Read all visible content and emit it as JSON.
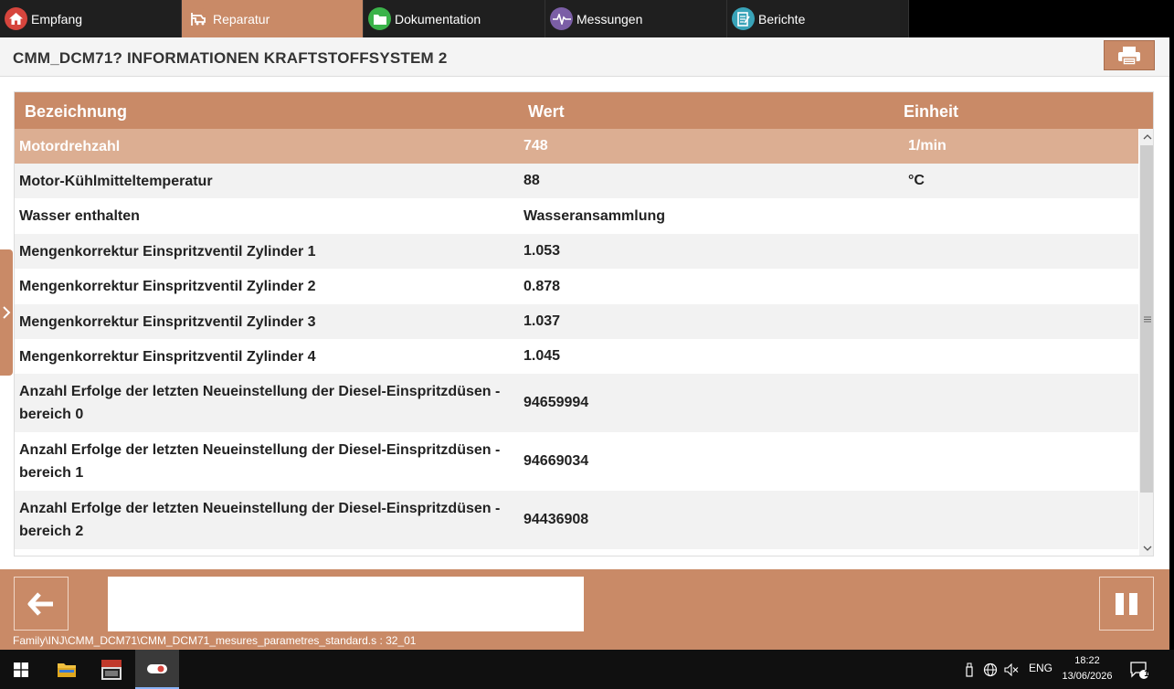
{
  "nav": {
    "tabs": [
      {
        "label": "Empfang",
        "icon": "home-icon",
        "color": "#d6453d"
      },
      {
        "label": "Reparatur",
        "icon": "lift-icon",
        "color": "#c98a67"
      },
      {
        "label": "Dokumentation",
        "icon": "folder-icon",
        "color": "#3bb34a"
      },
      {
        "label": "Messungen",
        "icon": "waveform-icon",
        "color": "#7b5ea6"
      },
      {
        "label": "Berichte",
        "icon": "report-icon",
        "color": "#39a3b8"
      }
    ],
    "active": "Reparatur"
  },
  "header": {
    "title": "CMM_DCM71? INFORMATIONEN KRAFTSTOFFSYSTEM 2"
  },
  "table": {
    "columns": [
      "Bezeichnung",
      "Wert",
      "Einheit"
    ],
    "rows": [
      {
        "name": "Motordrehzahl",
        "value": "748",
        "unit": "1/min"
      },
      {
        "name": "Motor-Kühlmitteltemperatur",
        "value": "88",
        "unit": "°C"
      },
      {
        "name": "Wasser enthalten",
        "value": "Wasseransammlung",
        "unit": ""
      },
      {
        "name": "Mengenkorrektur Einspritzventil Zylinder 1",
        "value": "1.053",
        "unit": ""
      },
      {
        "name": "Mengenkorrektur Einspritzventil Zylinder 2",
        "value": "0.878",
        "unit": ""
      },
      {
        "name": "Mengenkorrektur Einspritzventil Zylinder 3",
        "value": "1.037",
        "unit": ""
      },
      {
        "name": "Mengenkorrektur Einspritzventil Zylinder 4",
        "value": "1.045",
        "unit": ""
      },
      {
        "name": "Anzahl Erfolge der letzten Neueinstellung der Diesel-Einspritzdüsen - bereich 0",
        "value": "94659994",
        "unit": ""
      },
      {
        "name": "Anzahl Erfolge der letzten Neueinstellung der Diesel-Einspritzdüsen - bereich 1",
        "value": "94669034",
        "unit": ""
      },
      {
        "name": "Anzahl Erfolge der letzten Neueinstellung der Diesel-Einspritzdüsen - bereich 2",
        "value": "94436908",
        "unit": ""
      }
    ]
  },
  "footer": {
    "path": "Family\\INJ\\CMM_DCM71\\CMM_DCM71_mesures_parametres_standard.s : 32_01"
  },
  "taskbar": {
    "lang": "ENG",
    "time": "18:22",
    "date": "13/06/2026",
    "notification_count": "1"
  },
  "colors": {
    "accent": "#c98a67",
    "selected_row": "#dcae92"
  }
}
